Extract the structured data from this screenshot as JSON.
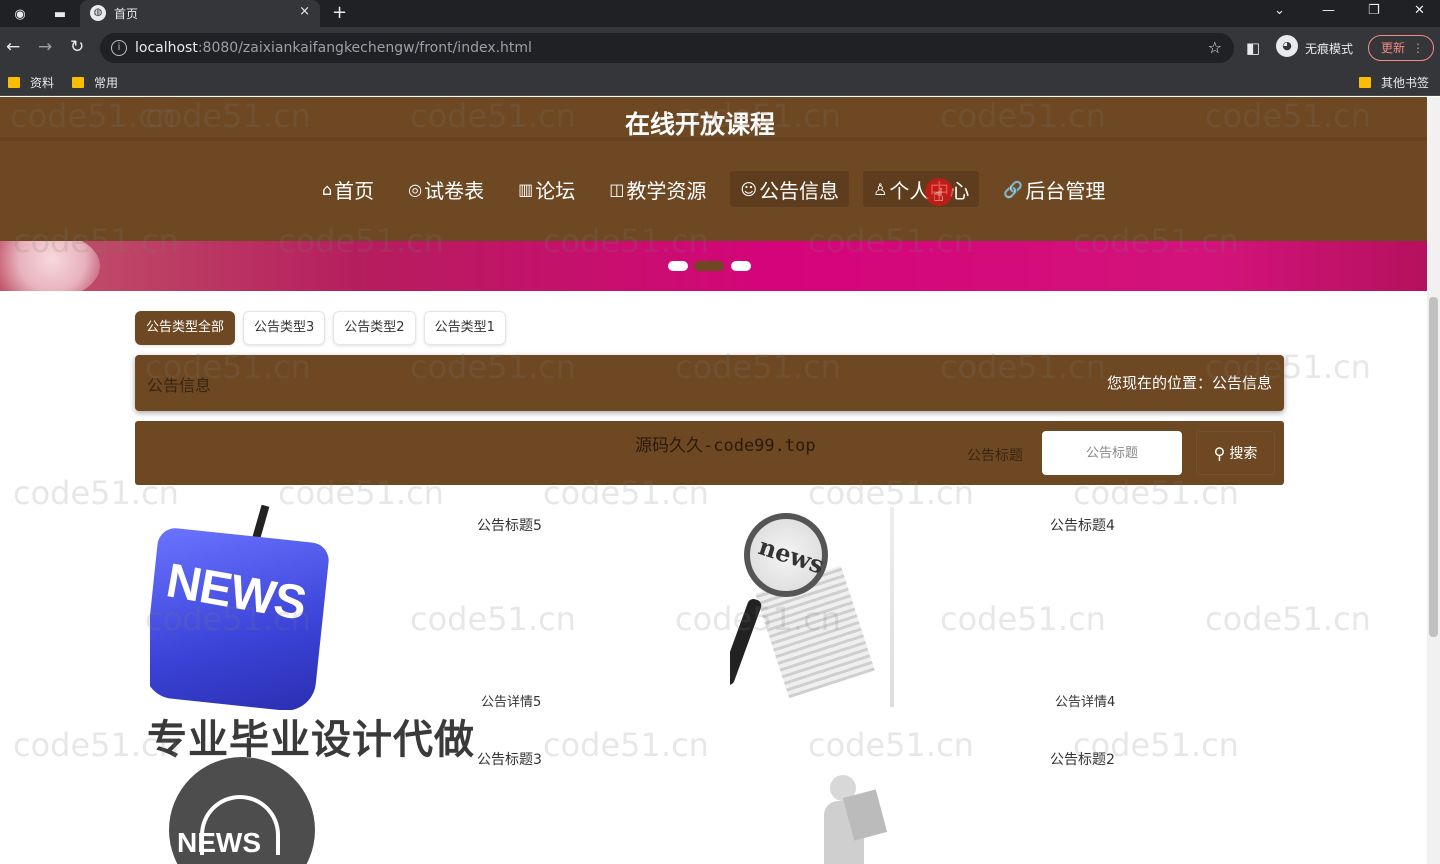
{
  "browser": {
    "tab_title": "首页",
    "tab_close": "×",
    "new_tab": "+",
    "url_host": "localhost",
    "url_rest": ":8080/zaixiankaifangkechengw/front/index.html",
    "incognito_label": "无痕模式",
    "update_label": "更新",
    "bookmarks": [
      "资料",
      "常用"
    ],
    "other_bookmarks": "其他书签"
  },
  "site": {
    "title": "在线开放课程",
    "nav": [
      {
        "icon": "⌂",
        "label": "首页"
      },
      {
        "icon": "◎",
        "label": "试卷表"
      },
      {
        "icon": "▥",
        "label": "论坛"
      },
      {
        "icon": "◫",
        "label": "教学资源"
      },
      {
        "icon": "☺",
        "label": "公告信息"
      },
      {
        "icon": "♙",
        "label": "个人中心"
      },
      {
        "icon": "🔗",
        "label": "后台管理"
      }
    ]
  },
  "categories": [
    "公告类型全部",
    "公告类型3",
    "公告类型2",
    "公告类型1"
  ],
  "breadcrumb": {
    "left": "公告信息",
    "right": "您现在的位置：公告信息"
  },
  "search": {
    "watermark": "源码久久-code99.top",
    "label": "公告标题",
    "placeholder": "公告标题",
    "button": "搜索"
  },
  "cards": [
    {
      "title": "公告标题5",
      "desc": "公告详情5",
      "image": "news-keyboard"
    },
    {
      "title": "公告标题4",
      "desc": "公告详情4",
      "image": "news-magnifier"
    },
    {
      "title": "公告标题3",
      "desc": "",
      "image": "news-globe"
    },
    {
      "title": "公告标题2",
      "desc": "",
      "image": "news-figure"
    }
  ],
  "promo_text": "专业毕业设计代做",
  "watermark_text": "code51.cn"
}
